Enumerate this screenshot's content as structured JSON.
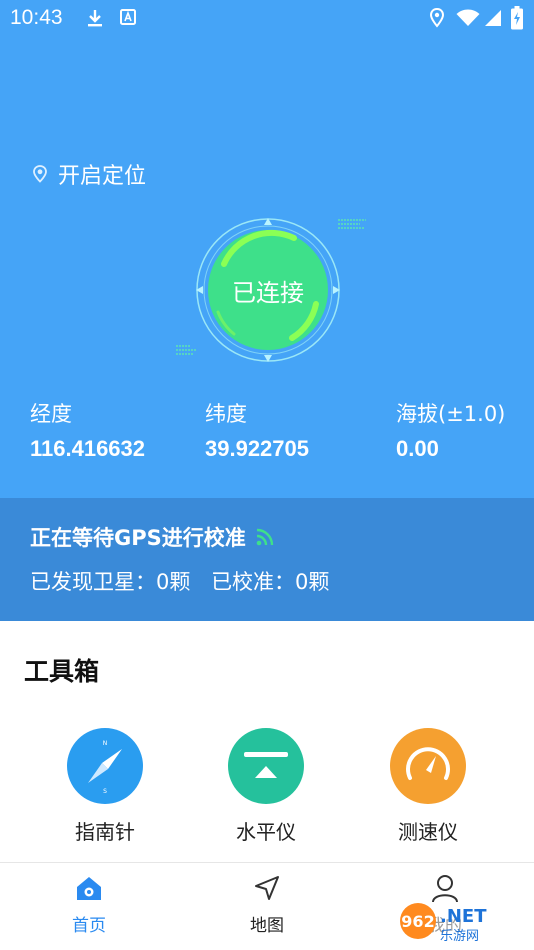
{
  "status_bar": {
    "time": "10:43"
  },
  "header": {
    "location_toggle_label": "开启定位",
    "connection_status": "已连接"
  },
  "coordinates": [
    {
      "label": "经度",
      "value": "116.416632"
    },
    {
      "label": "纬度",
      "value": "39.922705"
    },
    {
      "label": "海拔(±1.0)",
      "value": "0.00"
    }
  ],
  "gps": {
    "title": "正在等待GPS进行校准",
    "satellites": "已发现卫星：0颗",
    "calibrated": "已校准：0颗"
  },
  "toolbox": {
    "title": "工具箱",
    "tools": [
      {
        "label": "指南针",
        "icon": "compass-icon",
        "color": "#2a9df0"
      },
      {
        "label": "水平仪",
        "icon": "level-icon",
        "color": "#25c19c"
      },
      {
        "label": "测速仪",
        "icon": "speedometer-icon",
        "color": "#f5a030"
      }
    ]
  },
  "bottom_nav": [
    {
      "label": "首页",
      "icon": "home-icon",
      "active": true
    },
    {
      "label": "地图",
      "icon": "navigation-icon",
      "active": false
    },
    {
      "label": "我的",
      "icon": "user-icon",
      "active": false
    }
  ],
  "colors": {
    "header_bg": "#45a4f7",
    "gps_bg": "#3a8ad8",
    "accent": "#2a8af0",
    "dial_green": "#3ee08a"
  }
}
